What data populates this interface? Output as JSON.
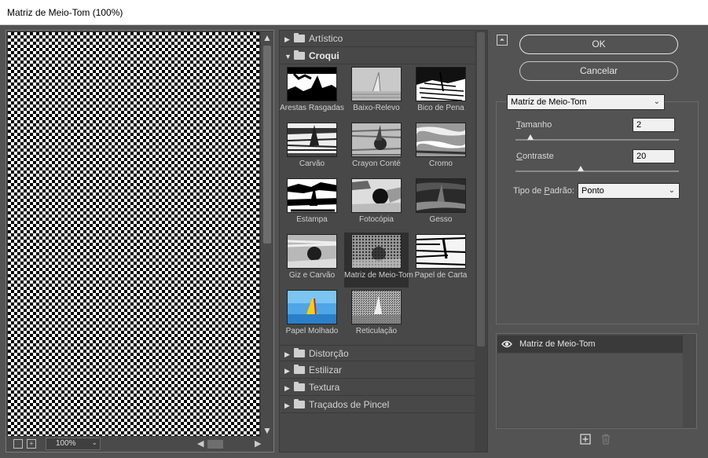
{
  "window": {
    "title": "Matriz de Meio-Tom (100%)"
  },
  "preview": {
    "zoom": "100%",
    "zoom_dropdown_icon": "chevron-down-icon"
  },
  "gallery": {
    "categories_top": [
      {
        "name": "Artístico",
        "open": false
      },
      {
        "name": "Croqui",
        "open": true
      }
    ],
    "filters": [
      {
        "label": "Arestas Rasgadas"
      },
      {
        "label": "Baixo-Relevo"
      },
      {
        "label": "Bico de Pena"
      },
      {
        "label": "Carvão"
      },
      {
        "label": "Crayon Conté"
      },
      {
        "label": "Cromo"
      },
      {
        "label": "Estampa"
      },
      {
        "label": "Fotocópia"
      },
      {
        "label": "Gesso"
      },
      {
        "label": "Giz e Carvão"
      },
      {
        "label": "Matriz de Meio-Tom"
      },
      {
        "label": "Papel de Carta"
      },
      {
        "label": "Papel Molhado"
      },
      {
        "label": "Reticulação"
      }
    ],
    "selected_filter": "Matriz de Meio-Tom",
    "categories_bottom": [
      {
        "name": "Distorção"
      },
      {
        "name": "Estilizar"
      },
      {
        "name": "Textura"
      },
      {
        "name": "Traçados de Pincel"
      }
    ]
  },
  "buttons": {
    "ok": "OK",
    "cancel": "Cancelar"
  },
  "settings": {
    "filter_select": "Matriz de Meio-Tom",
    "size_label_u": "T",
    "size_label_rest": "amanho",
    "size_value": "2",
    "size_min": 1,
    "size_max": 12,
    "contrast_label_u": "C",
    "contrast_label_rest": "ontraste",
    "contrast_value": "20",
    "contrast_min": 0,
    "contrast_max": 50,
    "pattern_label_pre": "Tipo de ",
    "pattern_label_u": "P",
    "pattern_label_rest": "adrão:",
    "pattern_value": "Ponto"
  },
  "layers": {
    "items": [
      {
        "name": "Matriz de Meio-Tom",
        "visible": true
      }
    ],
    "new_icon": "plus-square-icon",
    "delete_icon": "trash-icon"
  }
}
